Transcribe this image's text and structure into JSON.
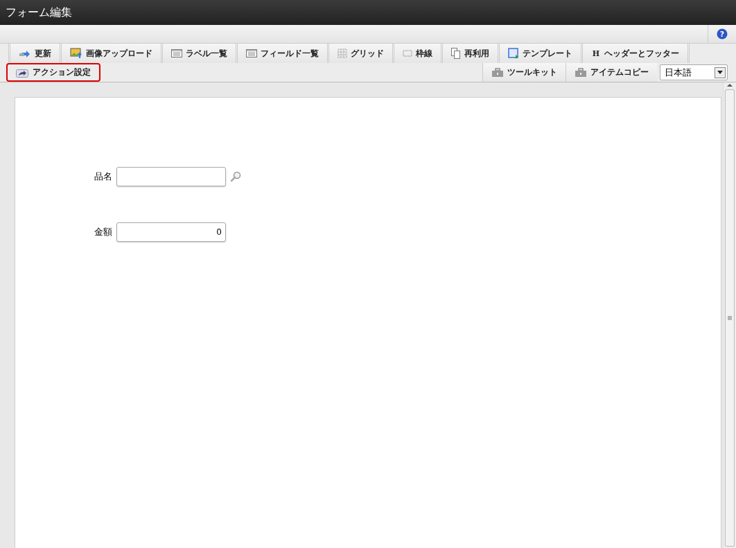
{
  "window": {
    "title": "フォーム編集"
  },
  "toolbar_row_1": [
    {
      "kind": "update",
      "label": "更新"
    },
    {
      "kind": "image-upload",
      "label": "画像アップロード"
    },
    {
      "kind": "list",
      "label": "ラベル一覧"
    },
    {
      "kind": "list",
      "label": "フィールド一覧"
    },
    {
      "kind": "grid",
      "label": "グリッド"
    },
    {
      "kind": "border",
      "label": "枠線"
    },
    {
      "kind": "reuse",
      "label": "再利用"
    },
    {
      "kind": "template",
      "label": "テンプレート"
    },
    {
      "kind": "letter",
      "glyph": "H",
      "label": "ヘッダーとフッター"
    }
  ],
  "toolbar_row_2_left": [
    {
      "kind": "action",
      "label": "アクション設定",
      "highlighted": true
    }
  ],
  "toolbar_row_2_right": [
    {
      "kind": "toolkit",
      "label": "ツールキット"
    },
    {
      "kind": "toolkit",
      "label": "アイテムコピー"
    }
  ],
  "language_select": {
    "value": "日本語"
  },
  "help_button": {
    "glyph": "?"
  },
  "form_fields": [
    {
      "kind": "lookup",
      "label": "品名"
    },
    {
      "kind": "number",
      "label": "金額",
      "value": "0"
    }
  ]
}
